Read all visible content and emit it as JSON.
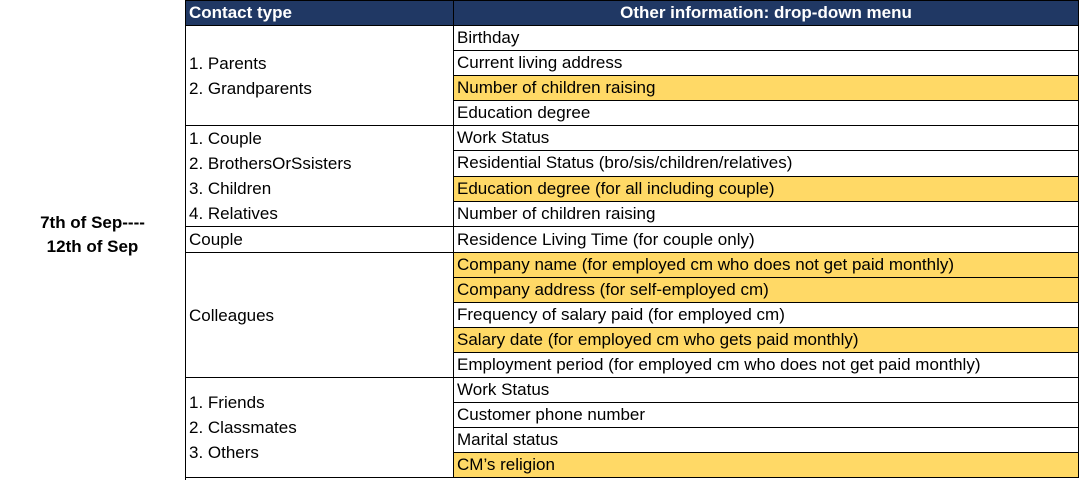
{
  "period": {
    "line1": "7th of Sep----",
    "line2": "12th of Sep"
  },
  "headers": {
    "contact_type": "Contact type",
    "other_info": "Other information: drop-down menu"
  },
  "highlight_color": "#ffd966",
  "header_color": "#203864",
  "groups": [
    {
      "types": [
        "1. Parents",
        "2. Grandparents"
      ],
      "options": [
        {
          "text": "Birthday",
          "highlighted": false
        },
        {
          "text": "Current living address",
          "highlighted": false
        },
        {
          "text": "Number of children raising",
          "highlighted": true
        },
        {
          "text": "Education degree",
          "highlighted": false
        }
      ]
    },
    {
      "types": [
        "1. Couple",
        "2. BrothersOrSsisters",
        "3. Children",
        "4. Relatives"
      ],
      "options": [
        {
          "text": "Work Status",
          "highlighted": false
        },
        {
          "text": "Residential Status   (bro/sis/children/relatives)",
          "highlighted": false
        },
        {
          "text": "Education degree (for all including couple)",
          "highlighted": true
        },
        {
          "text": "Number of children raising",
          "highlighted": false
        }
      ]
    },
    {
      "types": [
        "Couple"
      ],
      "options": [
        {
          "text": "Residence Living Time (for couple only)",
          "highlighted": false
        }
      ]
    },
    {
      "types": [
        "Colleagues"
      ],
      "options": [
        {
          "text": "Company name (for employed cm who does not get paid monthly)",
          "highlighted": true
        },
        {
          "text": "Company address (for self-employed cm)",
          "highlighted": true
        },
        {
          "text": "Frequency of salary paid  (for employed cm)",
          "highlighted": false
        },
        {
          "text": "Salary date (for employed cm who gets paid monthly)",
          "highlighted": true
        },
        {
          "text": "Employment period (for employed cm who does not get paid monthly)",
          "highlighted": false
        }
      ]
    },
    {
      "types": [
        "1. Friends",
        "2. Classmates",
        "3. Others"
      ],
      "options": [
        {
          "text": "Work Status",
          "highlighted": false
        },
        {
          "text": "Customer phone number",
          "highlighted": false
        },
        {
          "text": "Marital status",
          "highlighted": false
        },
        {
          "text": "CM’s religion",
          "highlighted": true
        }
      ]
    }
  ]
}
